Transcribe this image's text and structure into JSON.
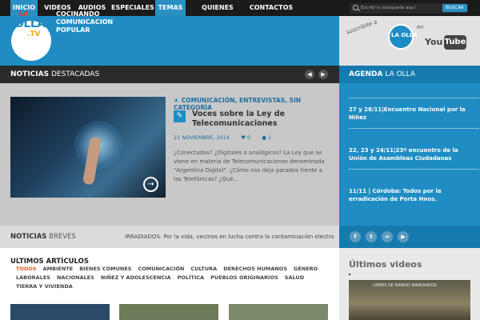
{
  "nav": {
    "items": [
      "INICIO",
      "VIDEOS",
      "AUDIOS",
      "ESPECIALES",
      "TEMAS",
      "QUIENES SOMOS",
      "CONTACTOS"
    ],
    "search_placeholder": "Escribí tu búsqueda aquí",
    "search_button": "BUSCAR"
  },
  "header": {
    "logo_la": "LA",
    "logo_olla": "OLLA",
    "logo_tv": ".TV",
    "tagline": "COCINANDO COMUNICACION POPULAR",
    "promo_text": "suscribite a",
    "promo_logo": "LA OLLA",
    "promo_en": "en",
    "youtube_you": "You",
    "youtube_tube": "Tube"
  },
  "featured": {
    "section_bold": "NOTICIAS",
    "section_rest": "DESTACADAS",
    "categories": "COMUNICACIÓN, ENTREVISTAS, SIN CATEGORÍA",
    "title": "Voces sobre la Ley de Telecomunicaciones",
    "date": "21 NOVIEMBRE, 2014",
    "views": "0",
    "comments": "1",
    "excerpt": "¿Conectados? ¿Digitales o analógicos? La Ley que se viene en materia de Telecomunicaciones denominada \"Argentina Digital\". ¿Cómo nos deja parados frente a las Telefónicas? ¿Qué..."
  },
  "agenda": {
    "title_bold": "AGENDA",
    "title_rest": "LA OLLA",
    "items": [
      "27 y 28/11|Encuentro Nacional por la Niñez",
      "22, 23 y 24/11|23º encuentro de la Unión de Asambleas Ciudadanas",
      "11/11 | Córdoba: Todos por la erradicación de Porta Hnos."
    ]
  },
  "breves": {
    "title_bold": "NOTICIAS",
    "title_rest": "BREVES",
    "ticker": "IRRADIADOS. Por la vida, vecinos en lucha contra la contaminación electro"
  },
  "articles": {
    "title": "ULTIMOS ARTÍCULOS",
    "filters": [
      "TODOS",
      "AMBIENTE",
      "BIENES COMUNES",
      "COMUNICACIÓN",
      "CULTURA",
      "DERECHOS HUMANOS",
      "GÉNERO",
      "LABORALES",
      "NACIONALES",
      "NIÑEZ Y ADOLESCENCIA",
      "POLÍTICA",
      "PUEBLOS ORIGINARIOS",
      "SALUD",
      "TIERRA Y VIVIENDA"
    ]
  },
  "videos": {
    "title": "Últimos videos",
    "caption": "LIBRES DE BARRIO IRRADIADOS"
  },
  "social": [
    "f",
    "t",
    "rss",
    "yt"
  ],
  "colors": {
    "brand_blue": "#1f8dc4",
    "dark": "#1b1b1b",
    "accent_orange": "#e65a2a"
  }
}
